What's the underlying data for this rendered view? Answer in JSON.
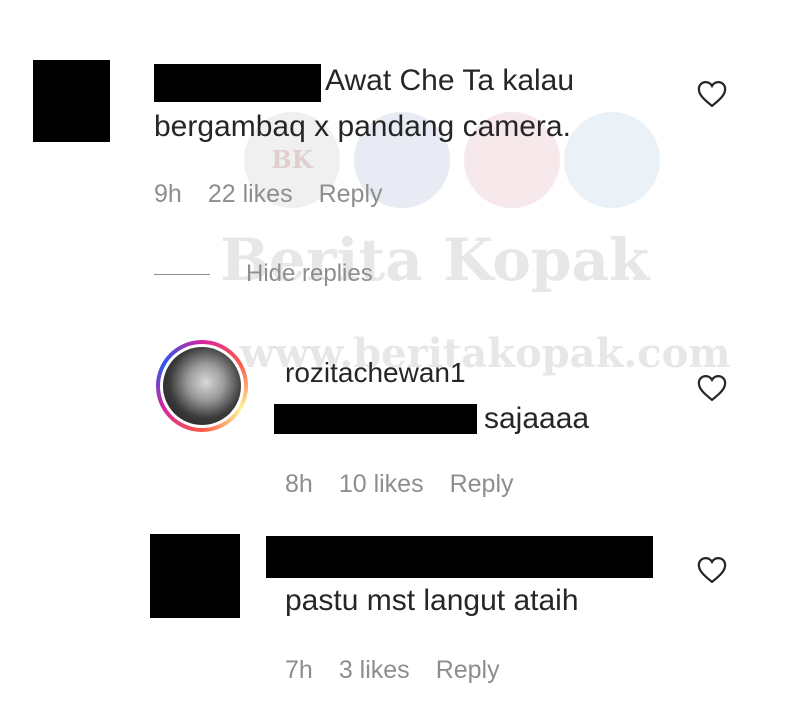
{
  "comments": [
    {
      "text_line1": "Awat Che Ta kalau",
      "text_line2": "bergambaq x pandang camera.",
      "time": "9h",
      "likes": "22 likes",
      "reply": "Reply"
    },
    {
      "username": "rozitachewan1",
      "text": "sajaaaa",
      "time": "8h",
      "likes": "10 likes",
      "reply": "Reply"
    },
    {
      "text": "pastu mst langut ataih",
      "time": "7h",
      "likes": "3 likes",
      "reply": "Reply"
    }
  ],
  "hide_replies": "Hide replies",
  "watermark": {
    "brand": "Berita Kopak",
    "url": "www.beritakopak.com",
    "logo": "BK"
  },
  "icons": {
    "like": "heart-icon"
  }
}
